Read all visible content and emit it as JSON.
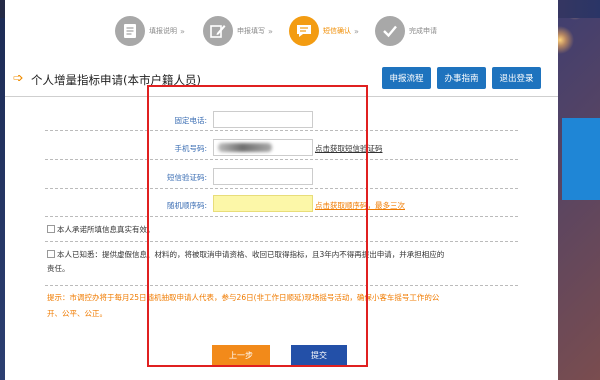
{
  "steps": [
    {
      "label": "填报说明",
      "icon": "document-icon",
      "active": false
    },
    {
      "label": "申报填写",
      "icon": "edit-icon",
      "active": false
    },
    {
      "label": "短信确认",
      "icon": "message-icon",
      "active": true
    },
    {
      "label": "完成申请",
      "icon": "check-icon",
      "active": false
    }
  ],
  "header": {
    "title": "个人增量指标申请(本市户籍人员)",
    "buttons": {
      "process": "申报流程",
      "guide": "办事指南",
      "logout": "退出登录"
    }
  },
  "form": {
    "landline_label": "固定电话:",
    "landline_value": "",
    "mobile_label": "手机号码:",
    "mobile_value": "",
    "get_sms_link": "点击获取短信验证码",
    "sms_code_label": "短信验证码:",
    "sms_code_value": "",
    "random_label": "随机顺序码:",
    "random_value": "",
    "get_random_link": "点击获取顺序码，最多三次"
  },
  "notes": {
    "promise": "本人承诺所填信息真实有效。",
    "aware_line1": "本人已知悉：提供虚假信息、材料的，将被取消申请资格、收回已取得指标，且3年内不得再提出申请，并承担相应的",
    "aware_line2": "责任。",
    "hint_line1": "提示：市调控办将于每月25日随机抽取申请人代表，参与26日(非工作日顺延)现场摇号活动，确保小客车摇号工作的公",
    "hint_line2": "开、公平、公正。"
  },
  "actions": {
    "prev": "上一步",
    "submit": "提交"
  },
  "colors": {
    "accent_orange": "#f39c12",
    "header_blue": "#1e73be",
    "submit_blue": "#2350a8",
    "highlight_red": "#e02020",
    "hint_orange": "#f07b00",
    "captcha_yellow": "#fcf7a8"
  }
}
